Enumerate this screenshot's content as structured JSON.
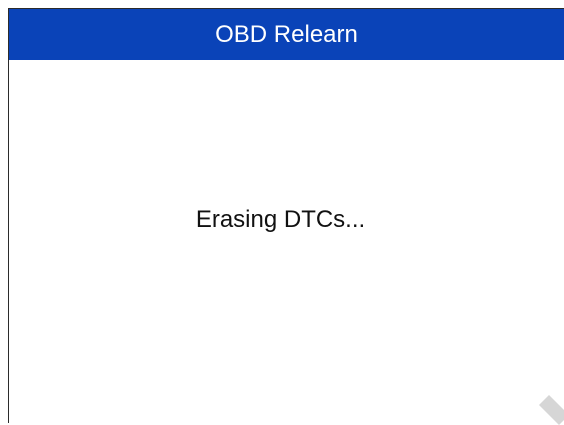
{
  "screen": {
    "title": "OBD Relearn",
    "status_message": "Erasing DTCs..."
  },
  "colors": {
    "title_bar": "#0a43b8",
    "title_text": "#ffffff",
    "body_background": "#ffffff",
    "status_text": "#111111"
  },
  "icons": {
    "corner_mark": "diagonal-stripe-icon"
  }
}
